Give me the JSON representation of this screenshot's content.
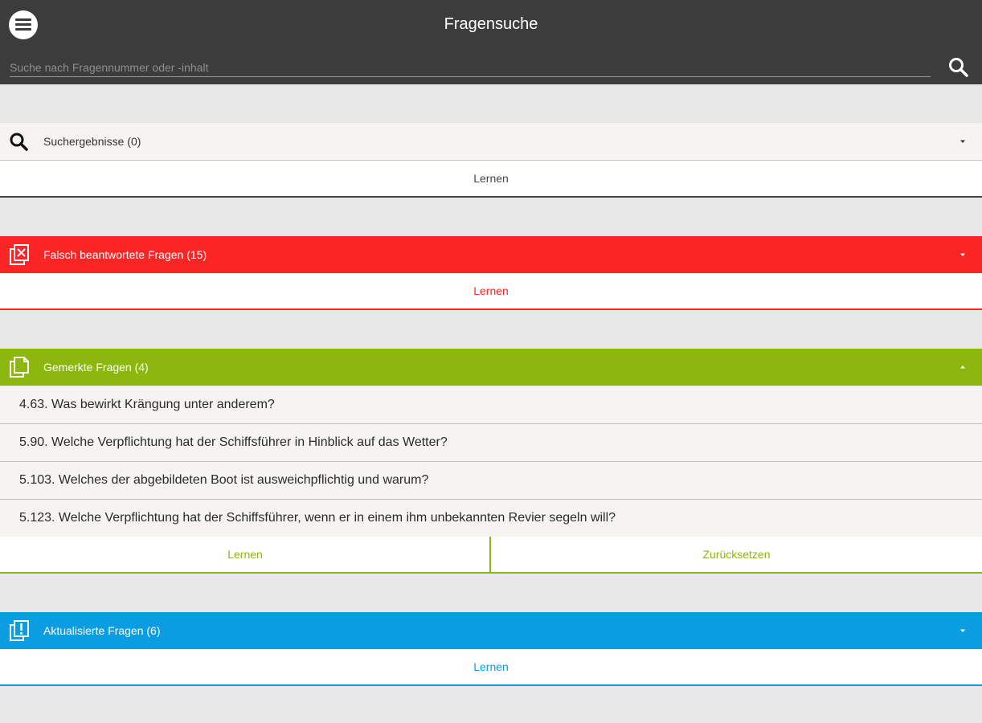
{
  "topbar": {
    "title": "Fragensuche",
    "search_placeholder": "Suche nach Fragennummer oder -inhalt",
    "search_value": ""
  },
  "colors": {
    "topbar": "#3c3c3c",
    "background": "#e8e8e8",
    "search_section": "#f5f4f0",
    "wrong": "#fb2525",
    "marked": "#8cb70e",
    "updated": "#0b9de2"
  },
  "sections": {
    "search": {
      "icon": "search-icon",
      "label": "Suchergebnisse (0)",
      "learn": "Lernen"
    },
    "wrong": {
      "icon": "wrong-questions-icon",
      "label": "Falsch beantwortete Fragen (15)",
      "learn": "Lernen"
    },
    "marked": {
      "icon": "marked-questions-icon",
      "label": "Gemerkte Fragen (4)",
      "items": [
        "4.63. Was bewirkt Krängung unter anderem?",
        "5.90. Welche Verpflichtung hat der Schiffsführer in Hinblick auf das Wetter?",
        "5.103. Welches der abgebildeten Boot ist ausweichpflichtig und warum?",
        "5.123. Welche Verpflichtung hat der Schiffsführer, wenn er in einem ihm unbekannten Revier segeln will?"
      ],
      "learn": "Lernen",
      "reset": "Zurücksetzen"
    },
    "updated": {
      "icon": "updated-questions-icon",
      "label": "Aktualisierte Fragen (6)",
      "learn": "Lernen"
    }
  }
}
